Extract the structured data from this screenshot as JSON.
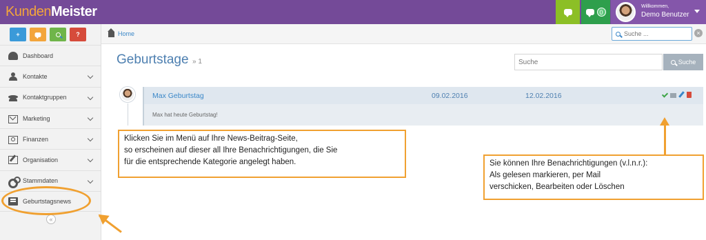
{
  "brand": {
    "part1": "Kunden",
    "part2": "Meister"
  },
  "topbar": {
    "notification_count": "0",
    "welcome": "Willkommen,",
    "username": "Demo Benutzer"
  },
  "quick_buttons": [
    "+",
    "",
    "",
    "?"
  ],
  "sidebar": {
    "items": [
      {
        "label": "Dashboard",
        "icon": "dashboard-icon",
        "expandable": false
      },
      {
        "label": "Kontakte",
        "icon": "user-icon",
        "expandable": true
      },
      {
        "label": "Kontaktgruppen",
        "icon": "group-icon",
        "expandable": true
      },
      {
        "label": "Marketing",
        "icon": "mail-icon",
        "expandable": true
      },
      {
        "label": "Finanzen",
        "icon": "money-icon",
        "expandable": true
      },
      {
        "label": "Organisation",
        "icon": "edit-icon",
        "expandable": true
      },
      {
        "label": "Stammdaten",
        "icon": "cogs-icon",
        "expandable": true
      },
      {
        "label": "Geburtstagsnews",
        "icon": "news-icon",
        "expandable": false
      }
    ],
    "collapse_label": "«"
  },
  "breadcrumb": {
    "home": "Home"
  },
  "top_search": {
    "placeholder": "Suche ..."
  },
  "page": {
    "title": "Geburtstage",
    "count": "» 1",
    "search_placeholder": "Suche",
    "search_button": "Suche"
  },
  "news": [
    {
      "name": "Max Geburtstag",
      "date_from": "09.02.2016",
      "date_to": "12.02.2016",
      "text": "Max hat heute Geburtstag!"
    }
  ],
  "annotations": {
    "left_line1": "Klicken Sie im Menü auf Ihre News-Beitrag-Seite,",
    "left_line2": "so erscheinen auf dieser all Ihre Benachrichtigungen, die Sie",
    "left_line3": "für die entsprechende Kategorie angelegt haben.",
    "right_line1": "Sie können Ihre Benachrichtigungen (v.l.n.r.):",
    "right_line2": "Als gelesen markieren, per Mail",
    "right_line3": "verschicken, Bearbeiten oder Löschen"
  },
  "colors": {
    "topbar": "#744a98",
    "accent_orange": "#f3a53b",
    "link_blue": "#3a87c8"
  }
}
